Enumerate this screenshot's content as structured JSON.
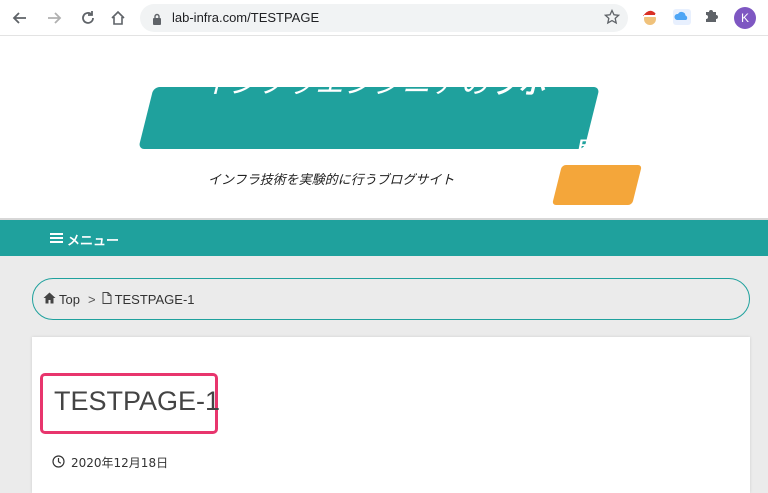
{
  "browser": {
    "url": "lab-infra.com/TESTPAGE",
    "profile_initial": "K",
    "icons": [
      "back-icon",
      "forward-icon",
      "reload-icon",
      "home-icon",
      "lock-icon",
      "star-icon",
      "extension-santa-icon",
      "extension-cloud-icon",
      "puzzle-icon"
    ]
  },
  "site": {
    "logo_text_main": "インフラエンジニアの",
    "logo_text_bold": "ラボ",
    "logo_badge": "Blog",
    "tagline": "インフラ技術を実験的に行うブログサイト",
    "menu_label": "メニュー"
  },
  "breadcrumb": {
    "home": "Top",
    "separator": ">",
    "current": "TESTPAGE-1"
  },
  "article": {
    "title": "TESTPAGE-1",
    "date": "2020年12月18日"
  },
  "colors": {
    "brand_teal": "#1fa19d",
    "badge_orange": "#f4a63a",
    "highlight_pink": "#e8356d"
  }
}
